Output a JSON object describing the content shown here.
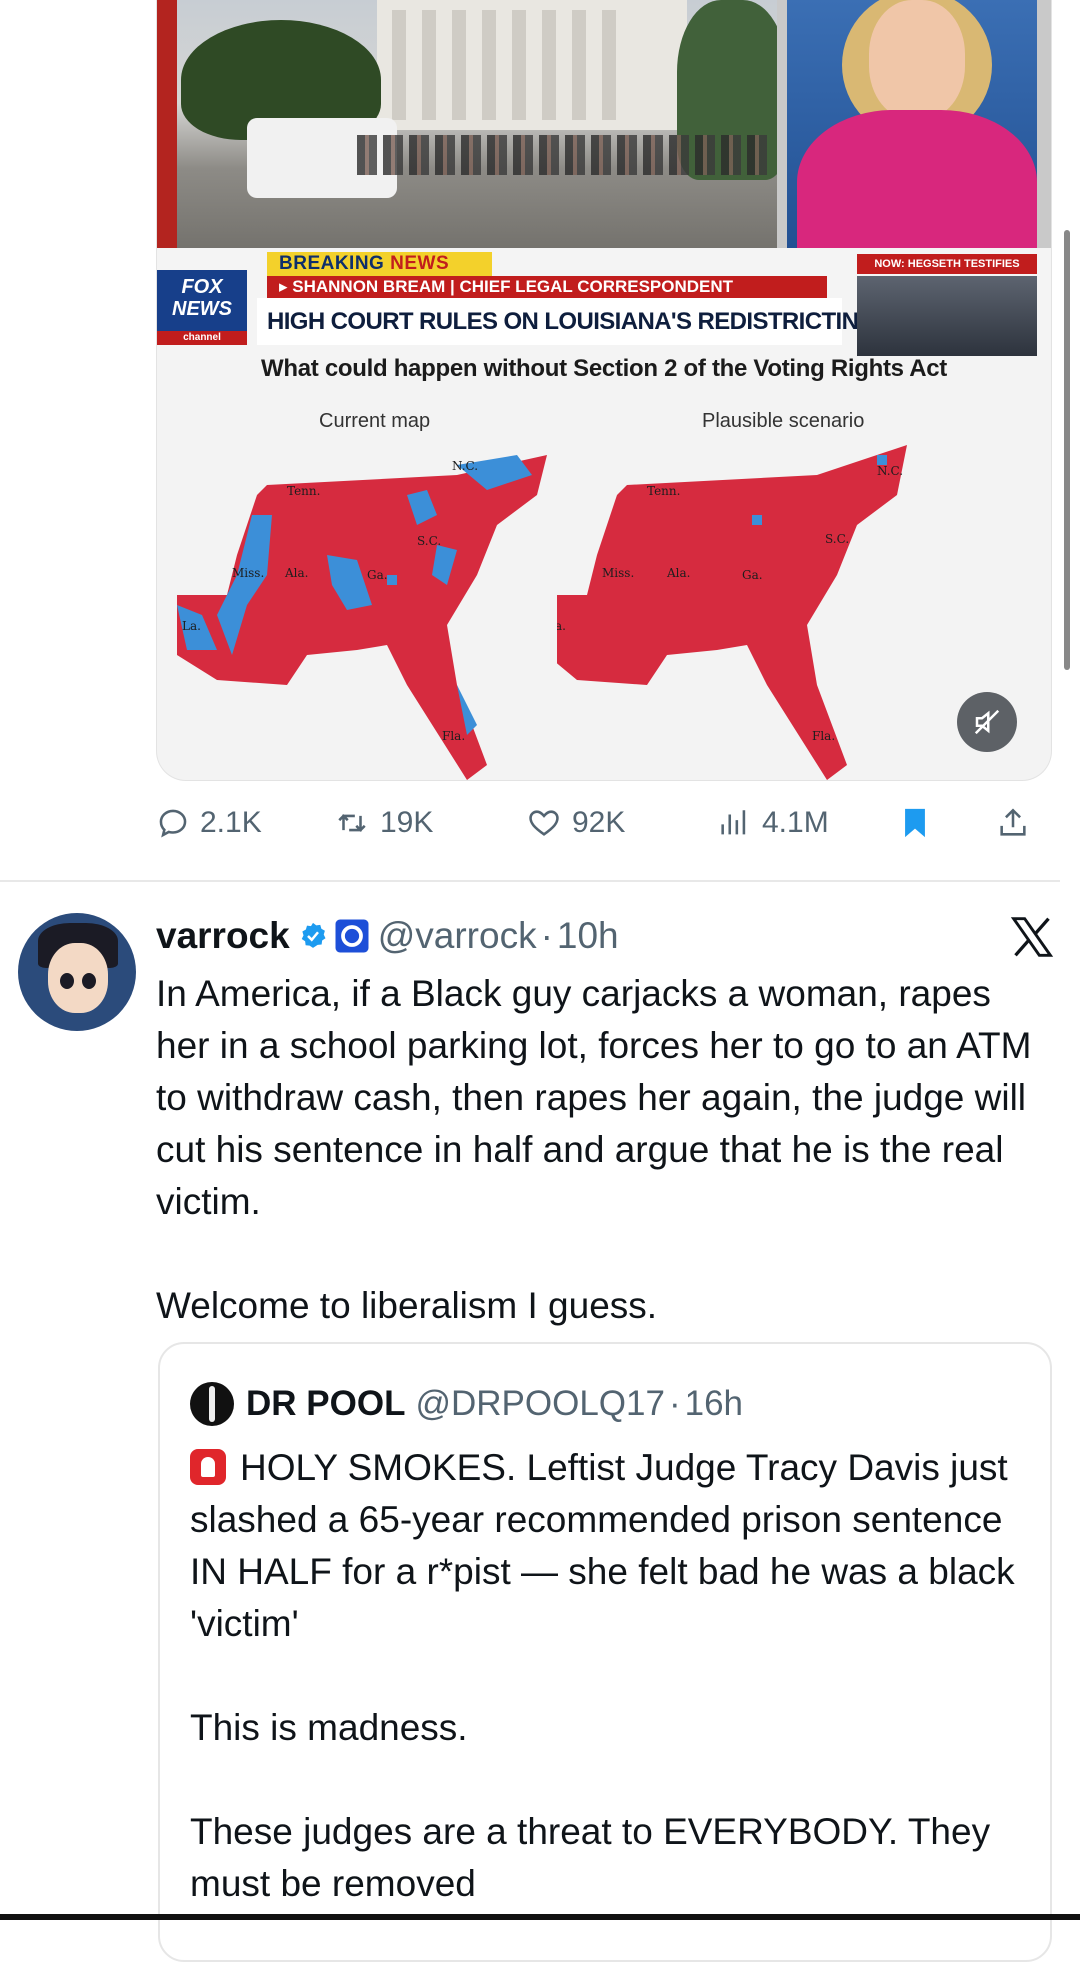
{
  "media": {
    "breaking_label": "BREAKING",
    "breaking_suffix": "NEWS",
    "reporter_line": "▸ SHANNON BREAM | CHIEF LEGAL CORRESPONDENT",
    "network_logo": "FOX NEWS",
    "network_sub": "channel",
    "headline": "HIGH COURT RULES ON LOUISIANA'S REDISTRICTING PLAN",
    "now_tag": "NOW: HEGSETH TESTIFIES",
    "graphic_title": "What could happen without Section 2 of the Voting Rights Act",
    "left_map_label": "Current map",
    "right_map_label": "Plausible scenario",
    "state_labels": [
      "Tenn.",
      "N.C.",
      "S.C.",
      "Miss.",
      "Ala.",
      "Ga.",
      "La.",
      "Fla."
    ],
    "mute_icon": "speaker-muted-icon",
    "colors": {
      "red": "#d62b3f",
      "blue": "#3c8fd8",
      "fox_blue": "#173f8a",
      "breaking_yellow": "#f3d12b"
    }
  },
  "actions": {
    "replies": "2.1K",
    "retweets": "19K",
    "likes": "92K",
    "views": "4.1M",
    "bookmark_color": "#1d9bf0"
  },
  "tweet": {
    "display_name": "varrock",
    "handle": "@varrock",
    "separator": "·",
    "time": "10h",
    "paragraphs": [
      "In America, if a Black guy carjacks a woman, rapes her in a school parking lot, forces her to go to an ATM to withdraw cash, then rapes her again, the judge will cut his sentence in half and argue that he is the real victim.",
      "Welcome to liberalism I guess."
    ]
  },
  "quote": {
    "display_name": "DR POOL",
    "handle": "@DRPOOLQ17",
    "separator": "·",
    "time": "16h",
    "paragraph_1": "HOLY SMOKES. Leftist Judge Tracy Davis just slashed a 65-year recommended prison sentence IN HALF for a r*pist — she felt bad he was a black 'victim'",
    "paragraph_2": "This is madness.",
    "paragraph_3": "These judges are a threat to EVERYBODY. They must be removed"
  }
}
